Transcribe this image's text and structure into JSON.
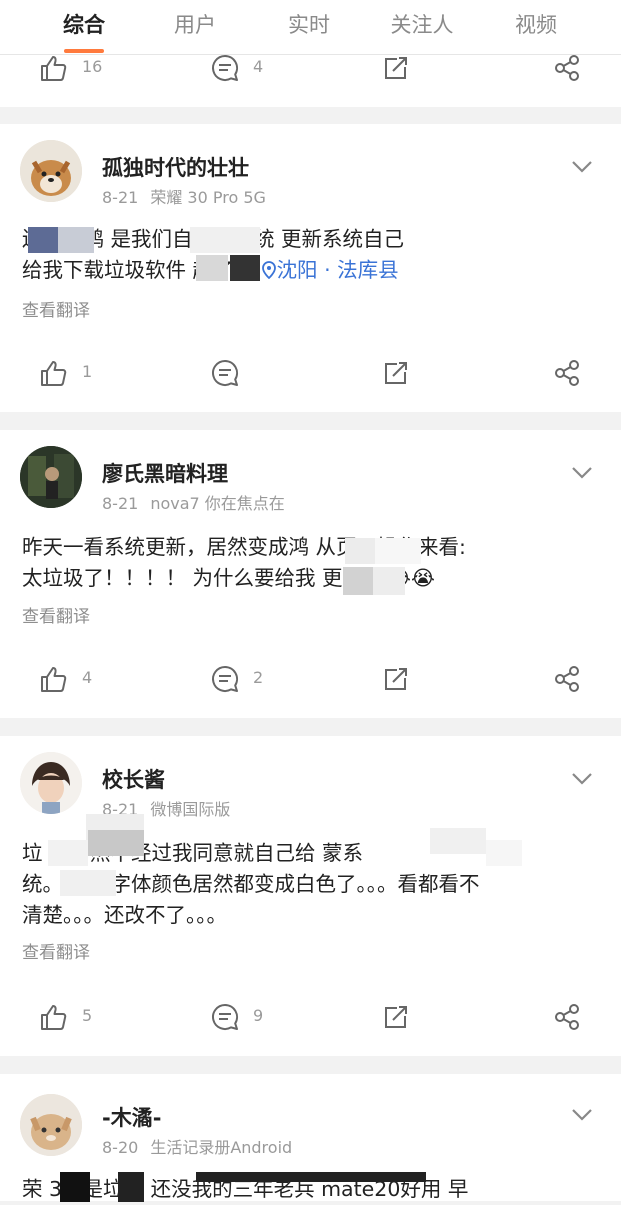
{
  "tabs": [
    "综合",
    "用户",
    "实时",
    "关注人",
    "视频"
  ],
  "colors": {
    "accent": "#ff7a3d",
    "location": "#3a73d6"
  },
  "posts": [
    {
      "actions": {
        "likes": "16",
        "comments": "4"
      }
    },
    {
      "username": "孤独时代的壮壮",
      "date": "8-21",
      "device": "荣耀 30 Pro 5G",
      "line1": "还得是鸿          是我们自己的系统 更新系统自己",
      "line2": "给我下载垃圾软件           起了？",
      "location": "沈阳 · 法库县",
      "translate": "查看翻译",
      "actions": {
        "likes": "1",
        "comments": ""
      }
    },
    {
      "username": "廖氏黑暗料理",
      "date": "8-21",
      "device": "nova7 你在焦点在",
      "line1": "昨天一看系统更新，居然变成鸿           从页面操作来看:",
      "line2": "太垃圾了！！！！ 为什么要给我          更新😭😭😭",
      "translate": "查看翻译",
      "actions": {
        "likes": "4",
        "comments": "2"
      }
    },
    {
      "username": "校长酱",
      "date": "8-21",
      "device": "微博国际版",
      "line1": "垃          机居然不经过我同意就自己给           蒙系",
      "line2": "统。       然后字体颜色居然都变成白色了。。。看都看不",
      "line3": "清楚。。。还改不了。。。",
      "translate": "查看翻译",
      "actions": {
        "likes": "5",
        "comments": "9"
      }
    },
    {
      "username": "-木潏-",
      "date": "8-20",
      "device": "生活记录册Android",
      "line1": "荣             3就是垃圾 还没我的三年老兵 mate20好用 早"
    }
  ],
  "icons": [
    "like-icon",
    "comment-icon",
    "repost-icon",
    "share-icon",
    "chevron-down-icon",
    "location-pin-icon"
  ]
}
